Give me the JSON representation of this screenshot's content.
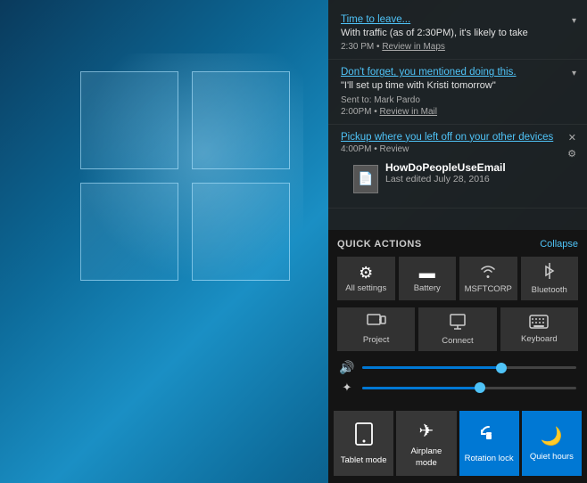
{
  "desktop": {
    "background": "Windows 10 desktop"
  },
  "notifications": {
    "items": [
      {
        "id": "maps",
        "title": "Time to leave...",
        "body": "With traffic (as of 2:30PM), it's likely to take",
        "meta_time": "2:30 PM",
        "meta_link": "Review in Maps",
        "has_chevron": true
      },
      {
        "id": "mail",
        "title": "Don't forget, you mentioned doing this.",
        "body": "\"I'll set up time with Kristi tomorrow\"",
        "meta_sent": "Sent to: Mark Pardo",
        "meta_time": "2:00PM",
        "meta_link": "Review in Mail",
        "has_chevron": true
      },
      {
        "id": "device",
        "title": "Pickup where you left off on your other devices",
        "has_close": true,
        "has_settings": true,
        "time": "4:00PM",
        "action": "Review",
        "doc_name": "HowDoPeopleUseEmail",
        "doc_sub": "Last edited July 28, 2016"
      }
    ]
  },
  "quick_actions": {
    "title": "QUICK ACTIONS",
    "collapse_label": "Collapse",
    "buttons_row1": [
      {
        "id": "all-settings",
        "icon": "⚙",
        "label": "All settings"
      },
      {
        "id": "battery",
        "icon": "🔋",
        "label": "Battery"
      },
      {
        "id": "msftcorp",
        "icon": "📶",
        "label": "MSFTCORP"
      },
      {
        "id": "bluetooth",
        "icon": "🔷",
        "label": "Bluetooth"
      }
    ],
    "buttons_row2": [
      {
        "id": "project",
        "icon": "🖥",
        "label": "Project"
      },
      {
        "id": "connect",
        "icon": "📡",
        "label": "Connect"
      },
      {
        "id": "keyboard",
        "icon": "⌨",
        "label": "Keyboard"
      }
    ],
    "volume_icon": "🔊",
    "volume_percent": 65,
    "brightness_icon": "✦",
    "brightness_percent": 55
  },
  "bottom_tiles": [
    {
      "id": "tablet-mode",
      "icon": "⬜",
      "label": "Tablet mode",
      "active": false
    },
    {
      "id": "airplane-mode",
      "icon": "✈",
      "label": "Airplane mode",
      "active": false
    },
    {
      "id": "rotation-lock",
      "icon": "🔄",
      "label": "Rotation lock",
      "active": true
    },
    {
      "id": "quiet-hours",
      "icon": "🌙",
      "label": "Quiet hours",
      "active": true
    }
  ]
}
